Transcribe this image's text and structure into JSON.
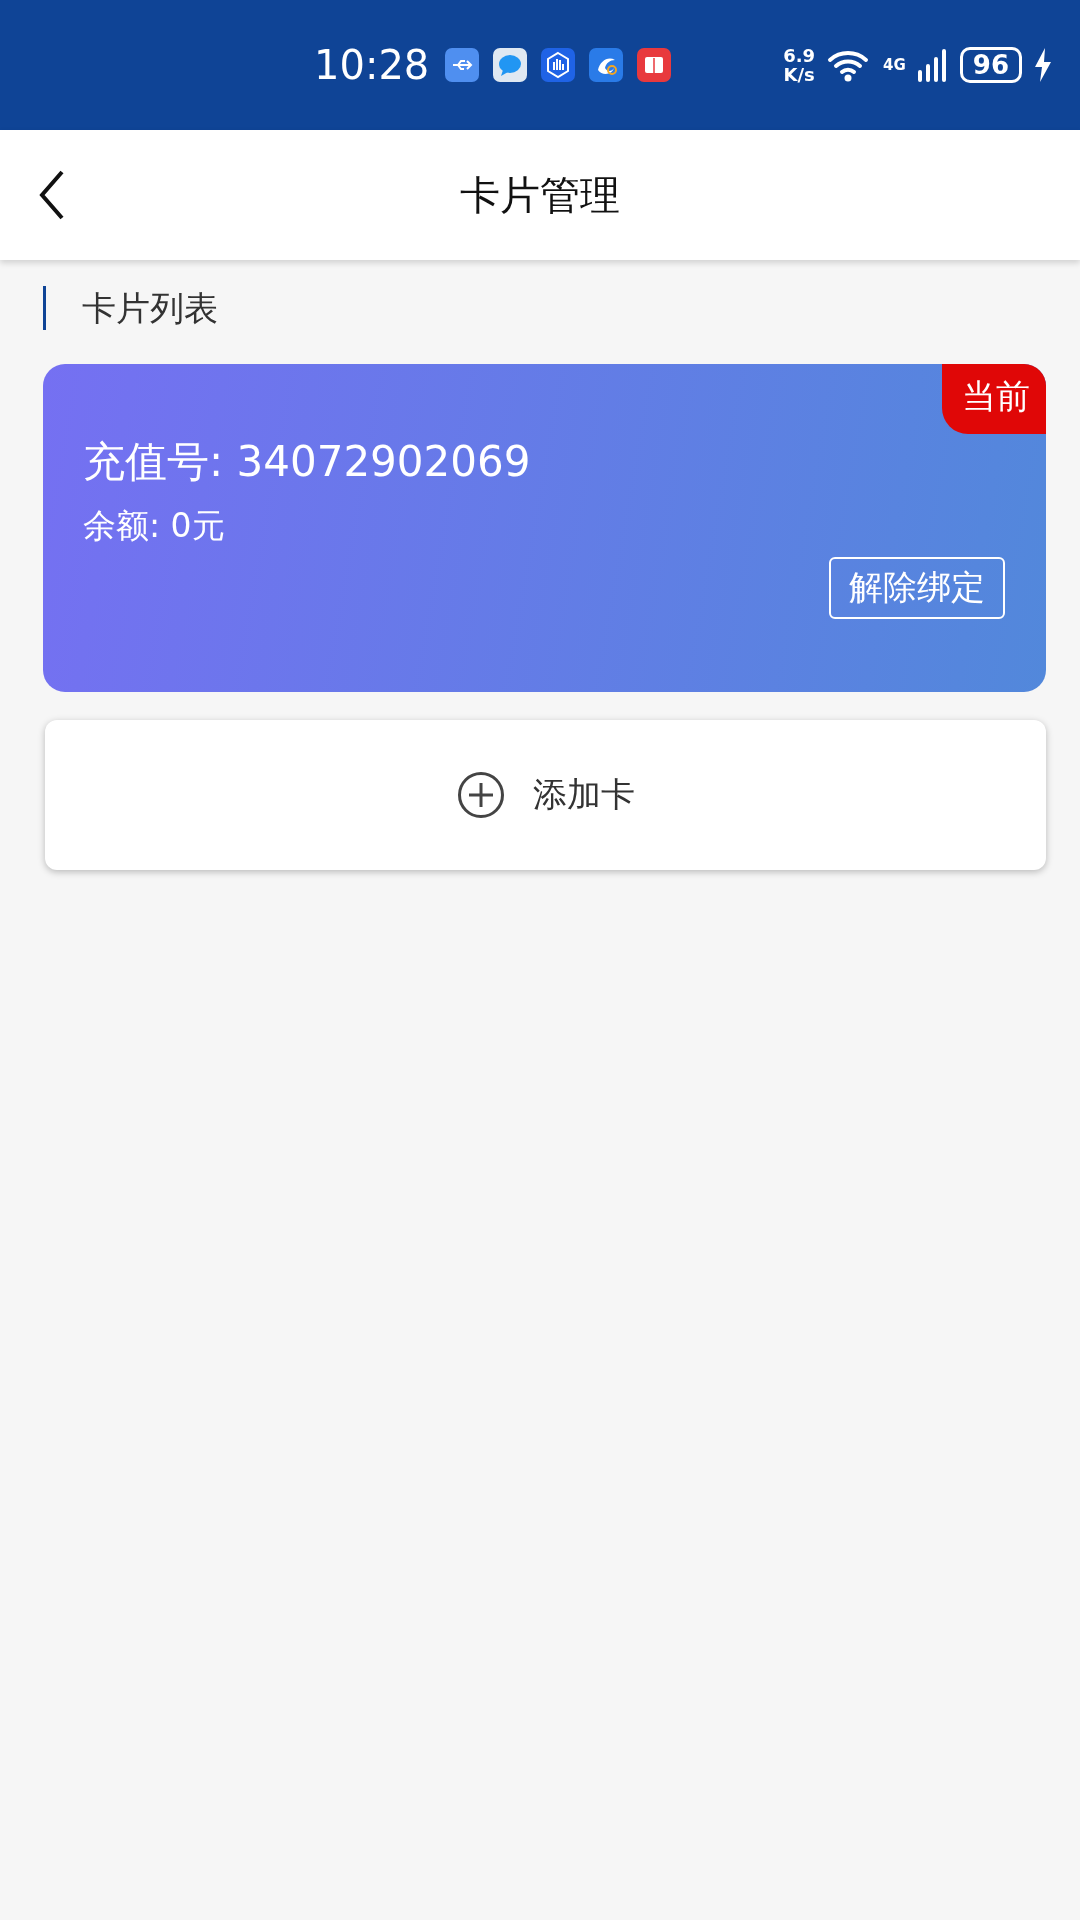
{
  "status_bar": {
    "time": "10:28",
    "speed_value": "6.9",
    "speed_unit": "K/s",
    "network": "4G",
    "battery": "96",
    "charging": true
  },
  "header": {
    "title": "卡片管理"
  },
  "section": {
    "title": "卡片列表"
  },
  "cards": [
    {
      "label": "充值号: 34072902069",
      "balance": "余额: 0元",
      "badge": "当前",
      "action": "解除绑定",
      "selected": true
    }
  ],
  "add_button": {
    "label": "添加卡"
  }
}
